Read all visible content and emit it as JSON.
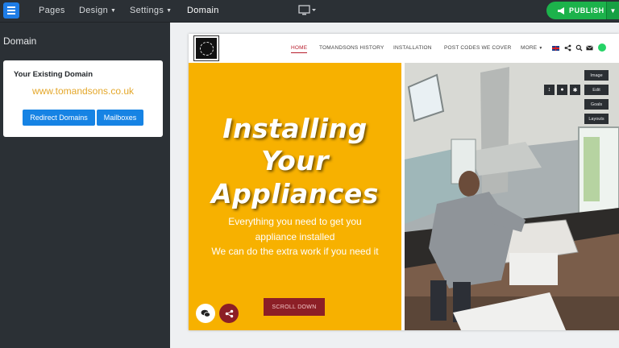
{
  "topbar": {
    "nav": [
      {
        "label": "Pages",
        "caret": false
      },
      {
        "label": "Design",
        "caret": true
      },
      {
        "label": "Settings",
        "caret": true
      },
      {
        "label": "Domain",
        "caret": false
      }
    ],
    "publish_label": "PUBLISH"
  },
  "left_panel": {
    "title": "Domain",
    "card": {
      "heading": "Your Existing Domain",
      "domain": "www.tomandsons.co.uk",
      "buttons": [
        "Redirect Domains",
        "Mailboxes"
      ]
    }
  },
  "site": {
    "nav": [
      "HOME",
      "TOMANDSONS HISTORY",
      "INSTALLATION",
      "POST CODES WE COVER",
      "MORE"
    ],
    "hero": {
      "title_lines": [
        "Installing",
        "Your",
        "Appliances"
      ],
      "subtitle_lines": [
        "Everything you need to get you",
        "appliance installed",
        "We can do the extra work if you need it"
      ],
      "scroll_label": "SCROLL DOWN"
    },
    "editor_tools": [
      "Image",
      "Edit",
      "Goals",
      "Layouts"
    ]
  },
  "colors": {
    "accent_blue": "#1683e4",
    "publish_green": "#1cb24b",
    "hero_yellow": "#f7b100",
    "brand_red": "#8c1f26",
    "domain_orange": "#e4a72a"
  },
  "icons": {
    "menu": "menu-icon",
    "device": "desktop-icon",
    "publish": "megaphone-icon",
    "share": "share-icon",
    "search": "search-icon",
    "email": "email-icon",
    "phone": "phone-icon",
    "whatsapp": "whatsapp-icon",
    "chat": "chat-icon"
  }
}
